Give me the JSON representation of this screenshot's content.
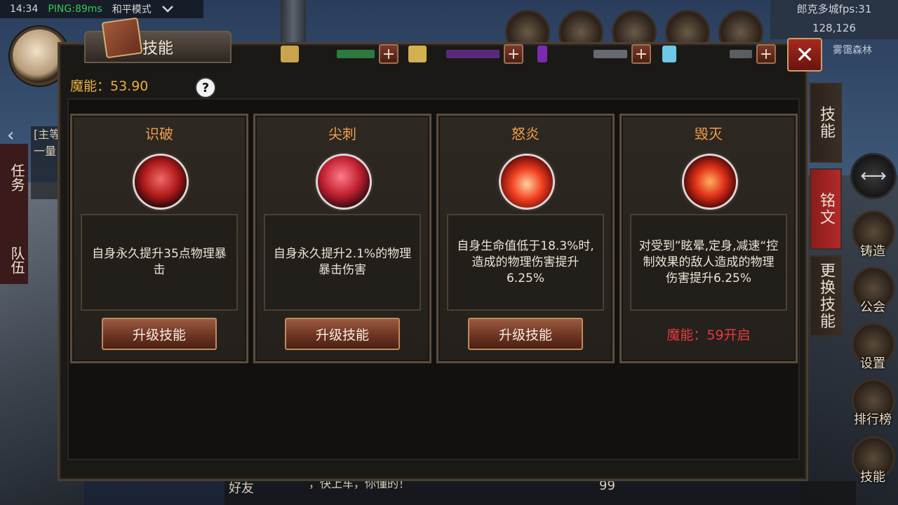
{
  "status": {
    "time": "14:34",
    "ping": "PING:89ms",
    "mode": "和平模式"
  },
  "map": {
    "fps": "郎克多城fps:31",
    "coords": "128,126",
    "area": "雾霭森林"
  },
  "panel": {
    "title": "技能",
    "mana_label": "魔能：53.90",
    "help": "?",
    "close": "✕"
  },
  "side_left": {
    "tasks": "任务",
    "team": "队伍",
    "quest_snippet": "[主等一量"
  },
  "tabs": {
    "skill": "技能",
    "rune": "铭文",
    "change": "更换技能"
  },
  "hud_right": [
    "铸造",
    "公会",
    "设置",
    "排行榜",
    "技能"
  ],
  "cards": [
    {
      "title": "识破",
      "desc": "自身永久提升35点物理暴击",
      "action": "升级技能"
    },
    {
      "title": "尖刺",
      "desc": "自身永久提升2.1%的物理暴击伤害",
      "action": "升级技能"
    },
    {
      "title": "怒炎",
      "desc": "自身生命值低于18.3%时,造成的物理伤害提升6.25%",
      "action": "升级技能"
    },
    {
      "title": "毁灭",
      "desc": "对受到”眩晕,定身,减速“控制效果的敌人造成的物理伤害提升6.25%",
      "locked": "魔能：59开启"
    }
  ],
  "bottom": {
    "friends": "好友",
    "chat": "，快上车，你懂的！",
    "count": "99"
  },
  "icons": {
    "chevron": "chevron-down-icon",
    "plus": "plus-icon",
    "help": "help-icon",
    "close": "close-icon"
  }
}
